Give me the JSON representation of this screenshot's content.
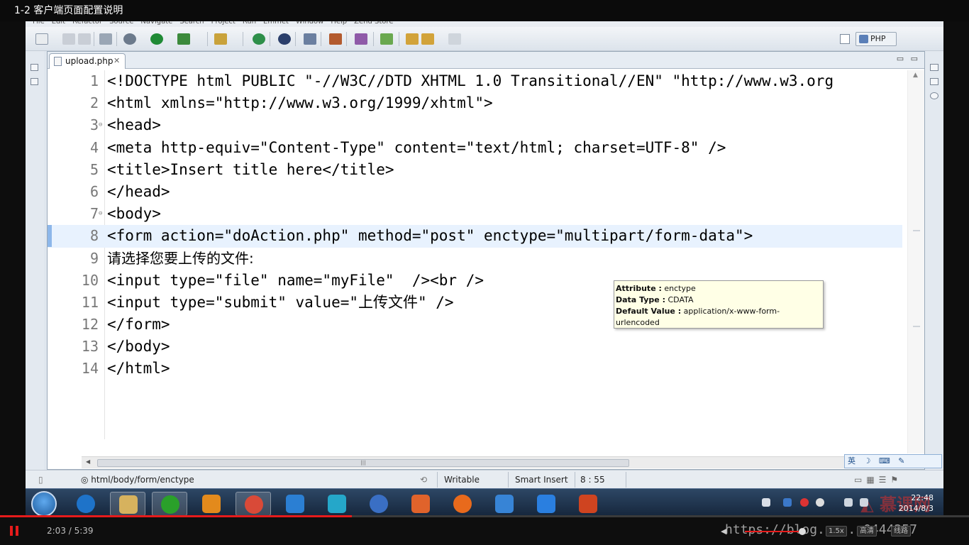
{
  "video": {
    "title": "1-2 客户端页面配置说明",
    "current_time": "2:03 / 5:39",
    "progress": 0.3628,
    "quality_labels": [
      "1.5x",
      "高清",
      "线路"
    ],
    "watermark_url": "https://blog.c...",
    "watermark_tail": "0444257"
  },
  "ide": {
    "menu": [
      "File",
      "Edit",
      "Refactor",
      "Source",
      "Navigate",
      "Search",
      "Project",
      "Run",
      "Emmet",
      "Window",
      "Help",
      "Zend Store"
    ],
    "perspective": "PHP",
    "tab": {
      "label": "upload.php",
      "close": "✕"
    },
    "lines": [
      {
        "n": "1",
        "text": "<!DOCTYPE html PUBLIC \"-//W3C//DTD XHTML 1.0 Transitional//EN\" \"http://www.w3.org"
      },
      {
        "n": "2",
        "text": "<html xmlns=\"http://www.w3.org/1999/xhtml\">"
      },
      {
        "n": "3",
        "text": "<head>"
      },
      {
        "n": "4",
        "text": "<meta http-equiv=\"Content-Type\" content=\"text/html; charset=UTF-8\" />"
      },
      {
        "n": "5",
        "text": "<title>Insert title here</title>"
      },
      {
        "n": "6",
        "text": "</head>"
      },
      {
        "n": "7",
        "text": "<body>"
      },
      {
        "n": "8",
        "text": "<form action=\"doAction.php\" method=\"post\" enctype=\"multipart/form-data\">"
      },
      {
        "n": "9",
        "text": "请选择您要上传的文件:"
      },
      {
        "n": "10",
        "text": "<input type=\"file\" name=\"myFile\"  /><br />"
      },
      {
        "n": "11",
        "text": "<input type=\"submit\" value=\"上传文件\" />"
      },
      {
        "n": "12",
        "text": "</form>"
      },
      {
        "n": "13",
        "text": "</body>"
      },
      {
        "n": "14",
        "text": "</html>"
      }
    ],
    "tooltip": {
      "attribute_label": "Attribute :",
      "attribute_value": "enctype",
      "datatype_label": "Data Type :",
      "datatype_value": "CDATA",
      "default_label": "Default Value :",
      "default_value": "application/x-www-form-urlencoded"
    },
    "ime": "英",
    "status": {
      "path": "html/body/form/enctype",
      "mode": "Writable",
      "insert": "Smart Insert",
      "position": "8 : 55"
    }
  },
  "taskbar": {
    "clock_time": "22:48",
    "clock_date": "2014/8/3",
    "apps": [
      "ie-icon",
      "explorer-icon",
      "green-app-icon",
      "media-player-icon",
      "chrome-icon",
      "baidu-app-icon",
      "cloud-app-icon",
      "feather-app-icon",
      "pdf-icon",
      "firefox-icon",
      "swift-app-icon",
      "qq-browser-icon",
      "powerpoint-icon"
    ]
  }
}
